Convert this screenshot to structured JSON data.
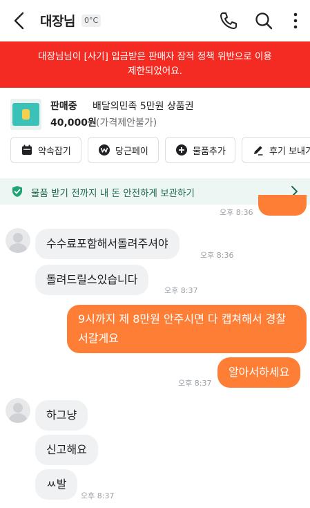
{
  "header": {
    "title": "대장님",
    "temperature": "0°C",
    "icons": [
      "back-arrow-icon",
      "phone-icon",
      "search-icon",
      "more-vertical-icon"
    ]
  },
  "banner": {
    "text": "대장님님이 [사기] 입금받은 판매자 잠적 정책 위반으로 이용 제한되었어요.",
    "color": "#f42b22"
  },
  "product": {
    "status": "판매중",
    "name": "배달의민족 5만원 상품권",
    "price": "40,000원",
    "price_note": "(가격제안불가)"
  },
  "actions": [
    {
      "label": "약속잡기",
      "icon": "calendar-icon"
    },
    {
      "label": "당근페이",
      "icon": "pay-icon"
    },
    {
      "label": "물품추가",
      "icon": "plus-circle-icon"
    },
    {
      "label": "후기 보내기",
      "icon": "pencil-icon"
    }
  ],
  "safe_payment": {
    "text": "물품 받기 전까지 내 돈 안전하게 보관하기",
    "icon": "shield-check-icon"
  },
  "messages": [
    {
      "side": "out",
      "text": "",
      "time": "오후 8:36"
    },
    {
      "side": "in",
      "text": "수수료포함해서돌려주셔야",
      "time": "오후 8:36"
    },
    {
      "side": "in",
      "text": "돌려드릴스있습니다",
      "time": "오후 8:37"
    },
    {
      "side": "out",
      "text": "9시까지 제 8만원 안주시면 다 캡쳐해서 경찰서갈게요",
      "time": ""
    },
    {
      "side": "out",
      "text": "알아서하세요",
      "time": "오후 8:37"
    },
    {
      "side": "in",
      "text": "하그냥",
      "time": ""
    },
    {
      "side": "in",
      "text": "신고해요",
      "time": ""
    },
    {
      "side": "in",
      "text": "ㅆ발",
      "time": "오후 8:37"
    }
  ],
  "colors": {
    "accent": "#ff7e36",
    "incoming_bubble": "#f0f1f3",
    "safe_bar": "#edf6f2",
    "safe_icon": "#1fa373"
  }
}
